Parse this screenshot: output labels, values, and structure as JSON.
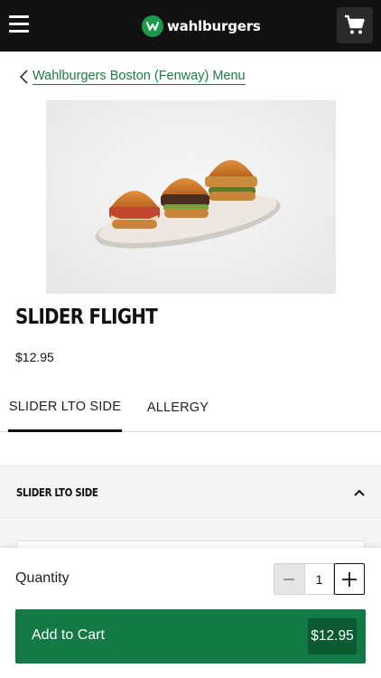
{
  "header": {
    "logo_text": "wahlburgers",
    "menu_icon": "hamburger-menu-icon",
    "cart_icon": "shopping-cart-icon",
    "background": "#111111"
  },
  "breadcrumb": {
    "label": "Wahlburgers Boston (Fenway) Menu",
    "icon": "chevron-left-icon"
  },
  "product": {
    "name": "SLIDER FLIGHT",
    "price": "$12.95"
  },
  "tabs": [
    {
      "label": "SLIDER LTO SIDE",
      "active": true
    },
    {
      "label": "ALLERGY",
      "active": false
    }
  ],
  "accordion": {
    "title": "SLIDER LTO SIDE",
    "expanded": true,
    "icon": "chevron-up-icon"
  },
  "order": {
    "quantity_label": "Quantity",
    "quantity": "1",
    "add_label": "Add to Cart",
    "total": "$12.95",
    "accent": "#137a46"
  }
}
